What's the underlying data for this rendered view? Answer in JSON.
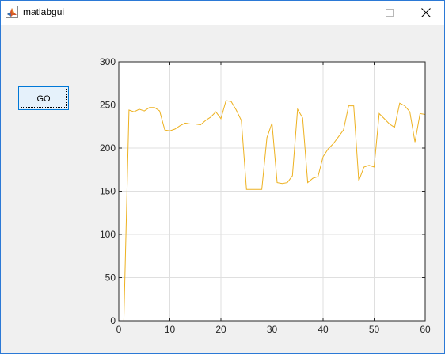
{
  "window": {
    "title": "matlabgui",
    "app_icon": "matlab-icon",
    "controls": {
      "minimize_icon": "minimize-icon",
      "maximize_icon": "maximize-icon",
      "close_icon": "close-icon"
    }
  },
  "go_button": {
    "label": "GO"
  },
  "colors": {
    "series": "#edb120",
    "axes": "#262626",
    "grid": "#dfdfdf",
    "background": "#f0f0f0",
    "button_border": "#0078d7",
    "button_fill": "#e5f1fb"
  },
  "chart_data": {
    "type": "line",
    "title": "",
    "xlabel": "",
    "ylabel": "",
    "xlim": [
      0,
      60
    ],
    "ylim": [
      0,
      300
    ],
    "xticks": [
      0,
      10,
      20,
      30,
      40,
      50,
      60
    ],
    "yticks": [
      0,
      50,
      100,
      150,
      200,
      250,
      300
    ],
    "grid": true,
    "box": true,
    "series": [
      {
        "color": "#edb120",
        "x": [
          1,
          2,
          3,
          4,
          5,
          6,
          7,
          8,
          9,
          10,
          11,
          12,
          13,
          14,
          15,
          16,
          17,
          18,
          19,
          20,
          21,
          22,
          23,
          24,
          25,
          26,
          27,
          28,
          29,
          30,
          31,
          32,
          33,
          34,
          35,
          36,
          37,
          38,
          39,
          40,
          41,
          42,
          43,
          44,
          45,
          46,
          47,
          48,
          49,
          50,
          51,
          52,
          53,
          54,
          55,
          56,
          57,
          58,
          59,
          60
        ],
        "y": [
          0,
          244,
          242,
          245,
          243,
          247,
          247,
          243,
          221,
          220,
          222,
          226,
          229,
          228,
          228,
          227,
          232,
          236,
          242,
          234,
          255,
          254,
          244,
          232,
          152,
          152,
          152,
          152,
          212,
          229,
          160,
          159,
          160,
          168,
          245,
          235,
          160,
          165,
          167,
          190,
          199,
          205,
          213,
          221,
          249,
          249,
          162,
          178,
          180,
          178,
          240,
          234,
          228,
          224,
          252,
          249,
          242,
          207,
          240,
          239
        ]
      }
    ]
  }
}
